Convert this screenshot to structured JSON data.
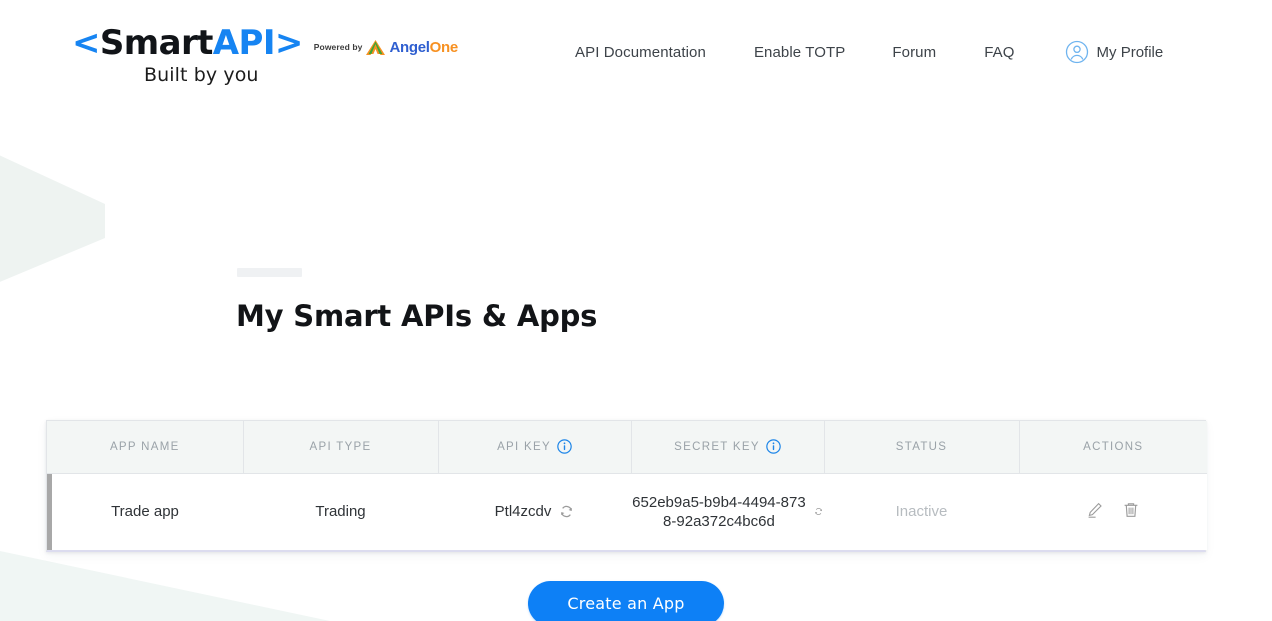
{
  "brand": {
    "logo_lt": "<",
    "logo_smart": "Smart",
    "logo_api": "API",
    "logo_gt": ">",
    "powered_by": "Powered by",
    "angel_first": "Angel",
    "angel_second": "One",
    "tagline": "Built by you"
  },
  "nav": {
    "documentation": "API Documentation",
    "enable_totp": "Enable TOTP",
    "forum": "Forum",
    "faq": "FAQ",
    "profile": "My Profile"
  },
  "main": {
    "page_title": "My Smart APIs & Apps",
    "create_button": "Create an App"
  },
  "table": {
    "columns": [
      {
        "label": "APP NAME",
        "has_info": false
      },
      {
        "label": "API TYPE",
        "has_info": false
      },
      {
        "label": "API KEY",
        "has_info": true
      },
      {
        "label": "SECRET KEY",
        "has_info": true
      },
      {
        "label": "STATUS",
        "has_info": false
      },
      {
        "label": "ACTIONS",
        "has_info": false
      }
    ],
    "rows": [
      {
        "app_name": "Trade app",
        "api_type": "Trading",
        "api_key": "Ptl4zcdv",
        "secret_key": "652eb9a5-b9b4-4494-8738-92a372c4bc6d",
        "status": "Inactive"
      }
    ]
  },
  "colors": {
    "accent_blue": "#0d80f6",
    "logo_blue": "#1684f2",
    "angel_blue": "#2f5fd0",
    "angel_orange": "#f79122",
    "header_bg": "#f3f6f5",
    "muted_text": "#9aa2a8",
    "inactive_text": "#b7bcc0"
  },
  "icons": {
    "info": "info-icon",
    "sync": "sync-icon",
    "edit": "pencil-icon",
    "delete": "trash-icon",
    "profile": "user-circle-icon"
  }
}
